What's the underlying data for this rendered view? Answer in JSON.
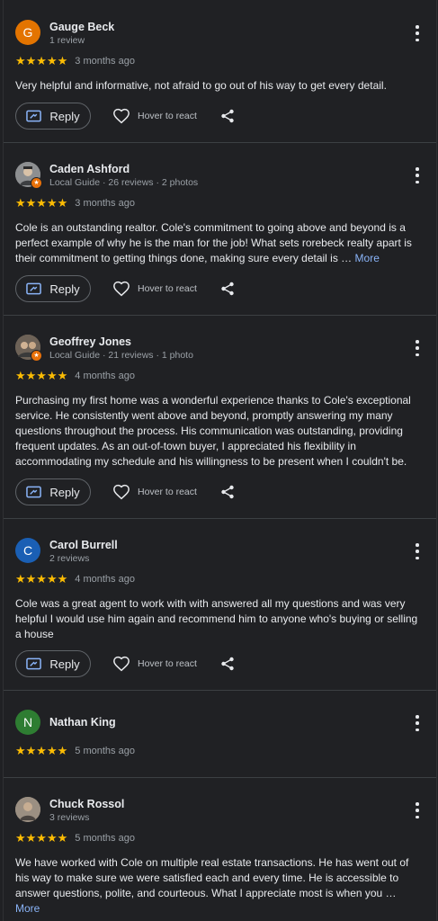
{
  "reviews": [
    {
      "name": "Gauge Beck",
      "meta": "1 review",
      "avatar_letter": "G",
      "avatar_color": "#e37400",
      "stars": "★★★★★",
      "date": "3 months ago",
      "text": "Very helpful and informative, not afraid to go out of his way to get every detail.",
      "more": ""
    },
    {
      "name": "Caden Ashford",
      "meta": "Local Guide · 26 reviews · 2 photos",
      "avatar_letter": "",
      "avatar_color": "#6b6f73",
      "stars": "★★★★★",
      "date": "3 months ago",
      "text": "Cole is an outstanding realtor. Cole's commitment to going above and beyond is a perfect example of why he is the man for the job! What sets rorebeck realty apart is their commitment to getting things done, making sure every detail is …",
      "more": "More"
    },
    {
      "name": "Geoffrey Jones",
      "meta": "Local Guide · 21 reviews · 1 photo",
      "avatar_letter": "",
      "avatar_color": "#7a6a5a",
      "stars": "★★★★★",
      "date": "4 months ago",
      "text": "Purchasing my first home was a wonderful experience thanks to Cole's exceptional service. He consistently went above and beyond, promptly answering my many questions throughout the process. His communication was outstanding, providing frequent updates. As an out-of-town buyer, I appreciated his flexibility in accommodating my schedule and his willingness to be present when I couldn't be.",
      "more": ""
    },
    {
      "name": "Carol Burrell",
      "meta": "2 reviews",
      "avatar_letter": "C",
      "avatar_color": "#1a5fb4",
      "stars": "★★★★★",
      "date": "4 months ago",
      "text": "Cole was a great agent to work with with answered all my questions and was very helpful I would use him again and recommend him to anyone who's buying or selling a house",
      "more": ""
    },
    {
      "name": "Nathan King",
      "meta": "",
      "avatar_letter": "N",
      "avatar_color": "#2e7d32",
      "stars": "★★★★★",
      "date": "5 months ago",
      "text": "",
      "more": ""
    },
    {
      "name": "Chuck Rossol",
      "meta": "3 reviews",
      "avatar_letter": "",
      "avatar_color": "#8a7d70",
      "stars": "★★★★★",
      "date": "5 months ago",
      "text": "We have worked with Cole on multiple real estate transactions. He has went out of his way to make sure we were satisfied each and every time. He is accessible to answer questions, polite, and courteous. What I appreciate most is when you …",
      "more": "More"
    }
  ],
  "actions": {
    "reply_label": "Reply",
    "react_label": "Hover to react"
  },
  "colors": {
    "background": "#202124",
    "star": "#fbbc04",
    "link": "#8ab4f8",
    "local_guide_badge": "#e8710a"
  },
  "icons": [
    "more-vert-icon",
    "reply-icon",
    "heart-outline-icon",
    "share-icon",
    "local-guide-badge-icon"
  ]
}
